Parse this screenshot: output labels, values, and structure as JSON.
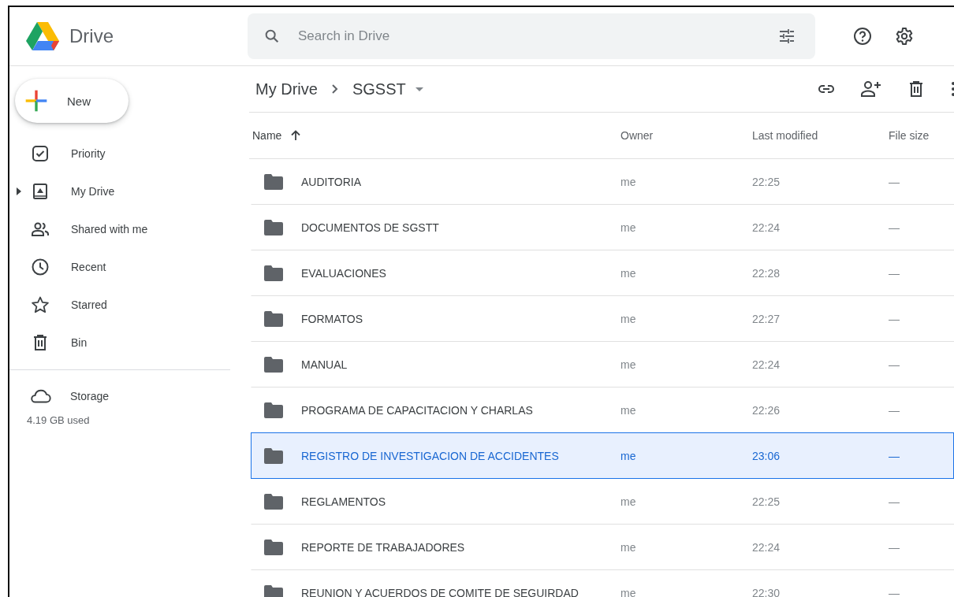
{
  "header": {
    "app_name": "Drive",
    "search": {
      "placeholder": "Search in Drive"
    }
  },
  "sidebar": {
    "new_button": "New",
    "items": [
      {
        "label": "Priority",
        "selected": false
      },
      {
        "label": "My Drive",
        "selected": false,
        "expanded": false
      },
      {
        "label": "Shared with me",
        "selected": false
      },
      {
        "label": "Recent",
        "selected": false
      },
      {
        "label": "Starred",
        "selected": false
      },
      {
        "label": "Bin",
        "selected": false
      }
    ],
    "storage": {
      "label": "Storage",
      "used": "4.19 GB used"
    }
  },
  "breadcrumb": [
    "My Drive",
    "SGSST"
  ],
  "table": {
    "columns": [
      {
        "label": "Name",
        "sorted": true
      },
      {
        "label": "Owner",
        "sorted": false
      },
      {
        "label": "Last modified",
        "sorted": false
      },
      {
        "label": "File size",
        "sorted": false
      }
    ],
    "rows": [
      {
        "name": "AUDITORIA",
        "owner": "me",
        "modified": "22:25",
        "size": "—",
        "selected": false
      },
      {
        "name": "DOCUMENTOS DE SGSTT",
        "owner": "me",
        "modified": "22:24",
        "size": "—",
        "selected": false
      },
      {
        "name": "EVALUACIONES",
        "owner": "me",
        "modified": "22:28",
        "size": "—",
        "selected": false
      },
      {
        "name": "FORMATOS",
        "owner": "me",
        "modified": "22:27",
        "size": "—",
        "selected": false
      },
      {
        "name": "MANUAL",
        "owner": "me",
        "modified": "22:24",
        "size": "—",
        "selected": false
      },
      {
        "name": "PROGRAMA DE CAPACITACION Y CHARLAS",
        "owner": "me",
        "modified": "22:26",
        "size": "—",
        "selected": false
      },
      {
        "name": "REGISTRO DE INVESTIGACION DE ACCIDENTES",
        "owner": "me",
        "modified": "23:06",
        "size": "—",
        "selected": true
      },
      {
        "name": "REGLAMENTOS",
        "owner": "me",
        "modified": "22:25",
        "size": "—",
        "selected": false
      },
      {
        "name": "REPORTE DE TRABAJADORES",
        "owner": "me",
        "modified": "22:24",
        "size": "—",
        "selected": false
      },
      {
        "name": "REUNION Y ACUERDOS DE COMITE DE SEGUIRDAD",
        "owner": "me",
        "modified": "22:30",
        "size": "—",
        "selected": false
      }
    ]
  }
}
